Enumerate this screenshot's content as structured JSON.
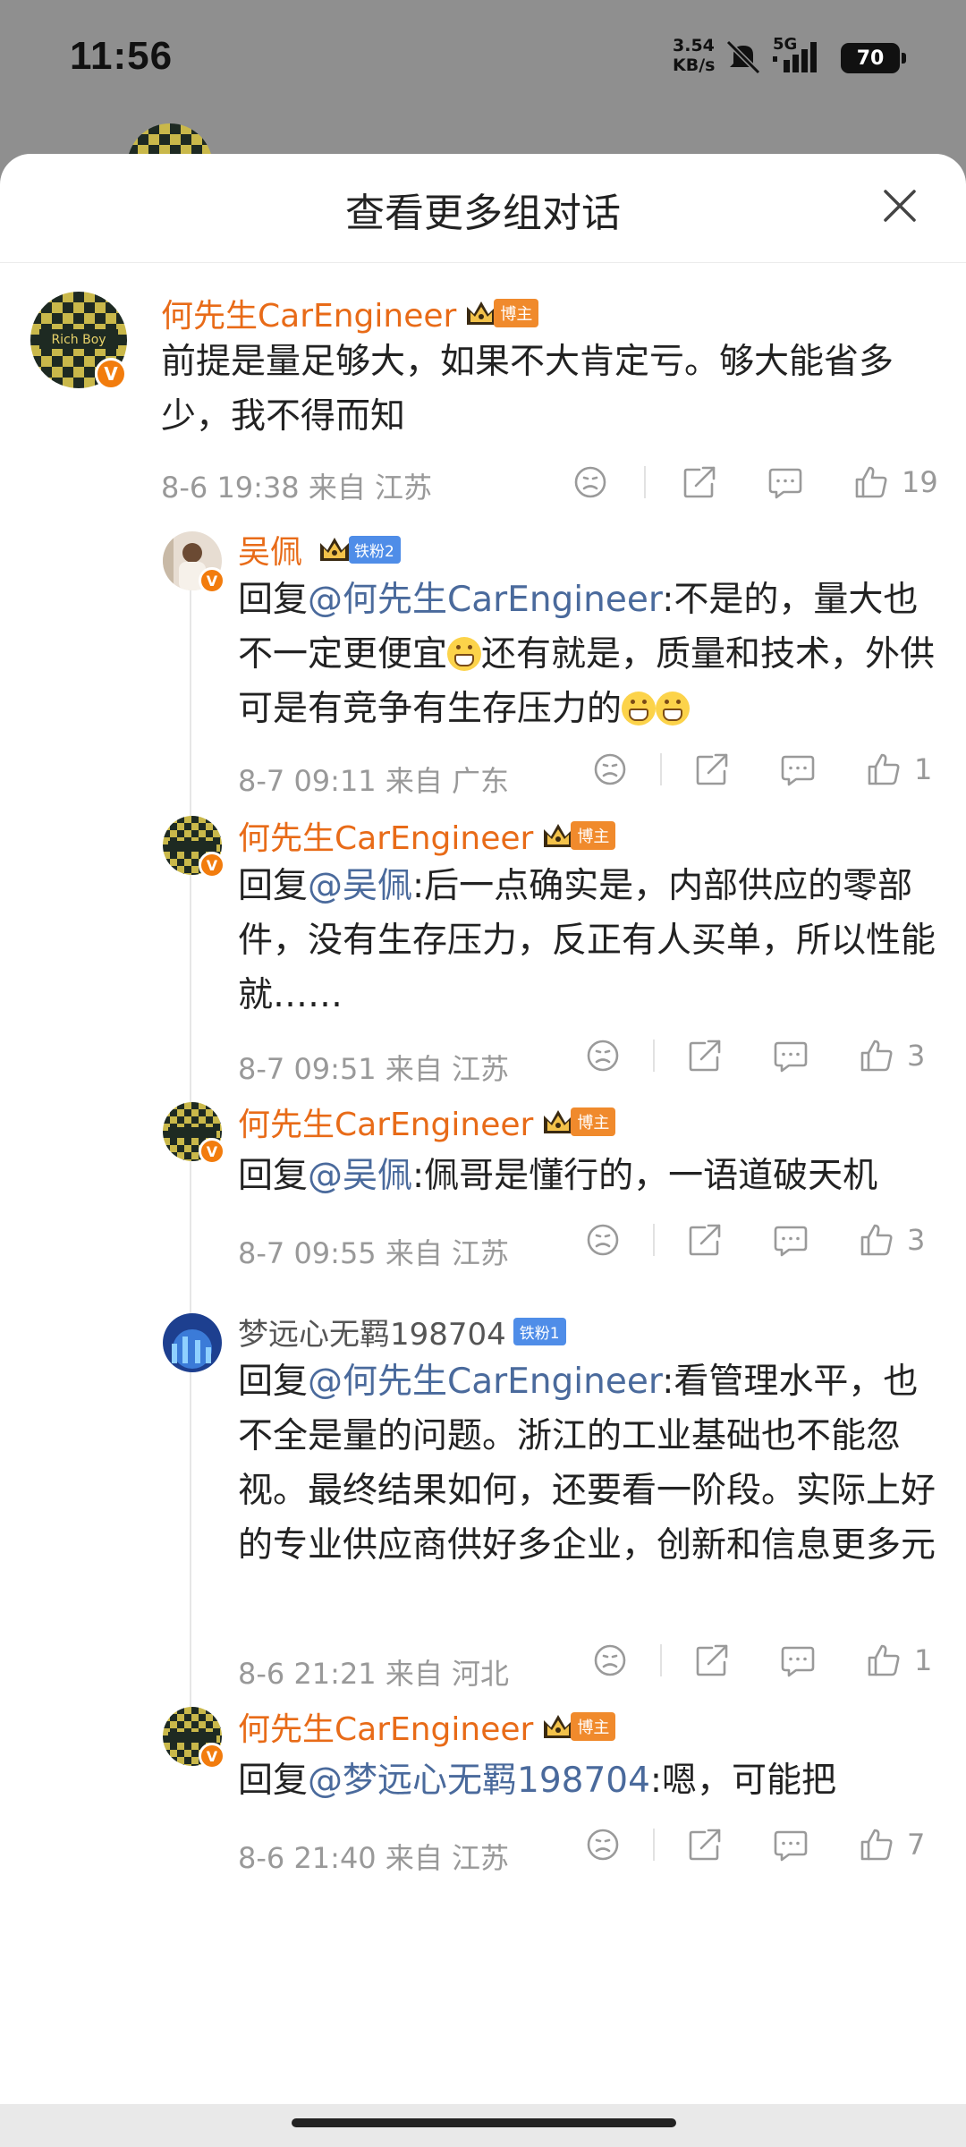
{
  "status": {
    "time": "11:56",
    "net_speed_value": "3.54",
    "net_speed_unit": "KB/s",
    "signal": "5G",
    "battery": "70"
  },
  "sheet": {
    "title": "查看更多组对话"
  },
  "comments": [
    {
      "user": "何先生CarEngineer",
      "tag": "博主",
      "text": "前提是量足够大，如果不大肯定亏。够大能省多少，我不得而知",
      "meta": "8-6 19:38 来自 江苏",
      "likes": "19"
    },
    {
      "user": "吴佩",
      "tag": "铁粉2",
      "reply_prefix": "回复",
      "mention": "@何先生CarEngineer",
      "text_a": ":不是的，量大也不一定更便宜",
      "text_b": "还有就是，质量和技术，外供可是有竞争有生存压力的",
      "meta": "8-7 09:11 来自 广东",
      "likes": "1"
    },
    {
      "user": "何先生CarEngineer",
      "tag": "博主",
      "reply_prefix": "回复",
      "mention": "@吴佩",
      "text": ":后一点确实是，内部供应的零部件，没有生存压力，反正有人买单，所以性能就……",
      "meta": "8-7 09:51 来自 江苏",
      "likes": "3"
    },
    {
      "user": "何先生CarEngineer",
      "tag": "博主",
      "reply_prefix": "回复",
      "mention": "@吴佩",
      "text": ":佩哥是懂行的，一语道破天机",
      "meta": "8-7 09:55 来自 江苏",
      "likes": "3"
    },
    {
      "user": "梦远心无羁198704",
      "tag": "铁粉1",
      "reply_prefix": "回复",
      "mention": "@何先生CarEngineer",
      "text": ":看管理水平，也不全是量的问题。浙江的工业基础也不能忽视。最终结果如何，还要看一阶段。实际上好的专业供应商供好多企业，创新和信息更多元",
      "meta": "8-6 21:21 来自 河北",
      "likes": "1"
    },
    {
      "user": "何先生CarEngineer",
      "tag": "博主",
      "reply_prefix": "回复",
      "mention": "@梦远心无羁198704",
      "text": ":嗯，可能把",
      "meta": "8-6 21:40 来自 江苏",
      "likes": "7"
    }
  ],
  "avatar_text": "Rich Boy",
  "verified_badge": "V",
  "colors": {
    "username": "#e86b18",
    "mention": "#4a6a9c",
    "badge_bozhu": "#f08a2c",
    "badge_fan": "#4f8de8"
  }
}
